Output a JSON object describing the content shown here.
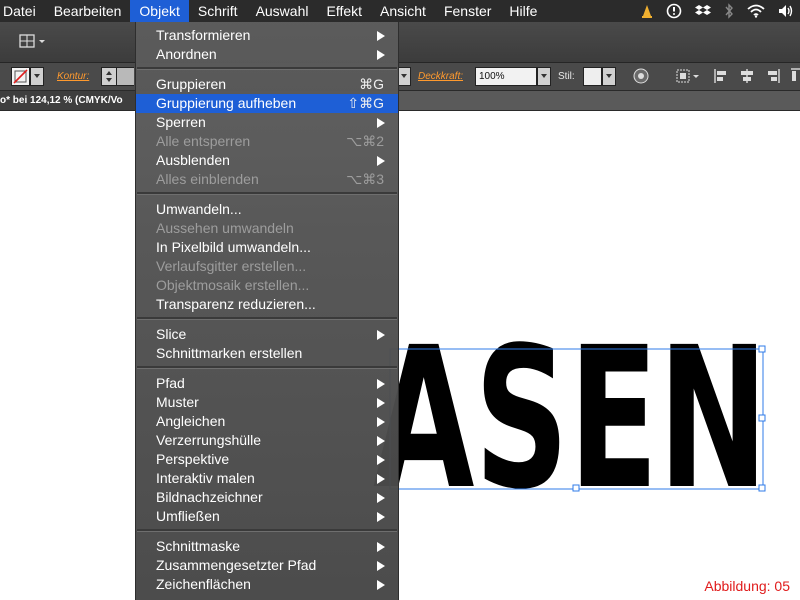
{
  "menubar": {
    "items": [
      "Datei",
      "Bearbeiten",
      "Objekt",
      "Schrift",
      "Auswahl",
      "Effekt",
      "Ansicht",
      "Fenster",
      "Hilfe"
    ],
    "active_index": 2,
    "status_icons": [
      "alert-cone-icon",
      "clock-icon",
      "dropbox-icon",
      "bluetooth-icon",
      "wifi-icon",
      "volume-icon"
    ]
  },
  "control_bar": {
    "kontur_label": "Kontur:",
    "deckkraft_label": "Deckkraft:",
    "deckkraft_value": "100%",
    "stil_label": "Stil:"
  },
  "document_tab": {
    "title": "o* bei 124,12 % (CMYK/Vo"
  },
  "canvas": {
    "artwork_text": "ASEN",
    "caption": "Abbildung: 05"
  },
  "menu": {
    "items": [
      {
        "label": "Transformieren",
        "shortcut": "",
        "submenu": true,
        "enabled": true
      },
      {
        "label": "Anordnen",
        "shortcut": "",
        "submenu": true,
        "enabled": true
      },
      {
        "label": "Gruppieren",
        "shortcut": "⌘G",
        "submenu": false,
        "enabled": true
      },
      {
        "label": "Gruppierung aufheben",
        "shortcut": "⇧⌘G",
        "submenu": false,
        "enabled": true,
        "highlighted": true
      },
      {
        "label": "Sperren",
        "shortcut": "",
        "submenu": true,
        "enabled": true
      },
      {
        "label": "Alle entsperren",
        "shortcut": "⌥⌘2",
        "submenu": false,
        "enabled": false
      },
      {
        "label": "Ausblenden",
        "shortcut": "",
        "submenu": true,
        "enabled": true
      },
      {
        "label": "Alles einblenden",
        "shortcut": "⌥⌘3",
        "submenu": false,
        "enabled": false
      },
      {
        "label": "Umwandeln...",
        "shortcut": "",
        "submenu": false,
        "enabled": true
      },
      {
        "label": "Aussehen umwandeln",
        "shortcut": "",
        "submenu": false,
        "enabled": false
      },
      {
        "label": "In Pixelbild umwandeln...",
        "shortcut": "",
        "submenu": false,
        "enabled": true
      },
      {
        "label": "Verlaufsgitter erstellen...",
        "shortcut": "",
        "submenu": false,
        "enabled": false
      },
      {
        "label": "Objektmosaik erstellen...",
        "shortcut": "",
        "submenu": false,
        "enabled": false
      },
      {
        "label": "Transparenz reduzieren...",
        "shortcut": "",
        "submenu": false,
        "enabled": true
      },
      {
        "label": "Slice",
        "shortcut": "",
        "submenu": true,
        "enabled": true
      },
      {
        "label": "Schnittmarken erstellen",
        "shortcut": "",
        "submenu": false,
        "enabled": true
      },
      {
        "label": "Pfad",
        "shortcut": "",
        "submenu": true,
        "enabled": true
      },
      {
        "label": "Muster",
        "shortcut": "",
        "submenu": true,
        "enabled": true
      },
      {
        "label": "Angleichen",
        "shortcut": "",
        "submenu": true,
        "enabled": true
      },
      {
        "label": "Verzerrungshülle",
        "shortcut": "",
        "submenu": true,
        "enabled": true
      },
      {
        "label": "Perspektive",
        "shortcut": "",
        "submenu": true,
        "enabled": true
      },
      {
        "label": "Interaktiv malen",
        "shortcut": "",
        "submenu": true,
        "enabled": true
      },
      {
        "label": "Bildnachzeichner",
        "shortcut": "",
        "submenu": true,
        "enabled": true
      },
      {
        "label": "Umfließen",
        "shortcut": "",
        "submenu": true,
        "enabled": true
      },
      {
        "label": "Schnittmaske",
        "shortcut": "",
        "submenu": true,
        "enabled": true
      },
      {
        "label": "Zusammengesetzter Pfad",
        "shortcut": "",
        "submenu": true,
        "enabled": true
      },
      {
        "label": "Zeichenflächen",
        "shortcut": "",
        "submenu": true,
        "enabled": true
      }
    ]
  },
  "colors": {
    "highlight": "#1e5fd6",
    "caption_red": "#e01b1b",
    "kontur_orange": "#ff9a2e",
    "selection_blue": "#2f7be8"
  }
}
